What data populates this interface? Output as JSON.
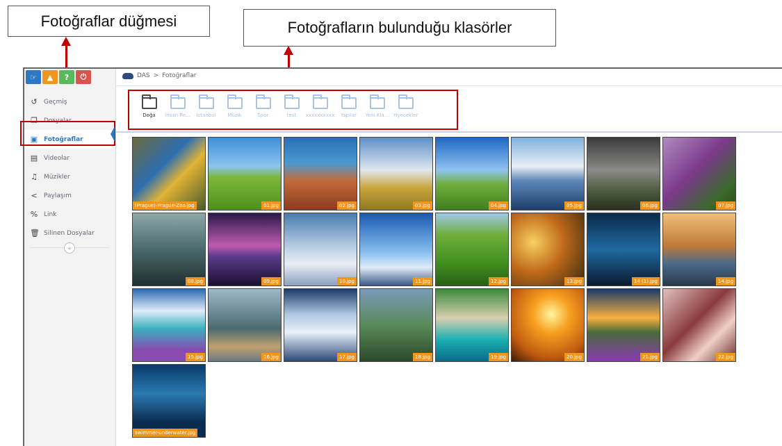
{
  "annotations": {
    "photos_button": "Fotoğraflar düğmesi",
    "folders": "Fotoğrafların bulunduğu klasörler"
  },
  "topbar": {
    "buttons": [
      {
        "name": "hand-icon",
        "color": "#2e77c5",
        "glyph": "☞"
      },
      {
        "name": "bell-icon",
        "color": "#f0961e",
        "glyph": "▲"
      },
      {
        "name": "help-icon",
        "color": "#5cb85c",
        "glyph": "?"
      },
      {
        "name": "power-icon",
        "color": "#d9534f",
        "glyph": "⏻"
      }
    ]
  },
  "sidebar": {
    "items": [
      {
        "label": "Geçmiş",
        "icon": "history-icon",
        "glyph": "↺",
        "active": false
      },
      {
        "label": "Dosyalar",
        "icon": "files-icon",
        "glyph": "❐",
        "active": false
      },
      {
        "label": "Fotoğraflar",
        "icon": "image-icon",
        "glyph": "▣",
        "active": true
      },
      {
        "label": "Videolar",
        "icon": "film-icon",
        "glyph": "▤",
        "active": false
      },
      {
        "label": "Müzikler",
        "icon": "music-icon",
        "glyph": "♫",
        "active": false
      },
      {
        "label": "Paylaşım",
        "icon": "share-icon",
        "glyph": "<",
        "active": false
      },
      {
        "label": "Link",
        "icon": "link-icon",
        "glyph": "%",
        "active": false
      },
      {
        "label": "Silinen Dosyalar",
        "icon": "trash-icon",
        "glyph": "🗑",
        "active": false
      }
    ],
    "collapse": "«"
  },
  "breadcrumb": {
    "root": "DAS",
    "separator": ">",
    "current": "Fotoğraflar"
  },
  "folders": [
    {
      "label": "Doğa",
      "selected": true
    },
    {
      "label": "İnsan Re...",
      "selected": false
    },
    {
      "label": "İstanbul",
      "selected": false
    },
    {
      "label": "Müzik",
      "selected": false
    },
    {
      "label": "Spor",
      "selected": false
    },
    {
      "label": "test",
      "selected": false
    },
    {
      "label": "xxxxxxxxxx",
      "selected": false
    },
    {
      "label": "Yapılar",
      "selected": false
    },
    {
      "label": "Yeni Kla...",
      "selected": false
    },
    {
      "label": "Yiyecekler",
      "selected": false
    }
  ],
  "photos": [
    {
      "label": "(Prague)-Prague-Zoo.jpg",
      "bg": "linear-gradient(135deg,#6b6a3a,#2d6db0 40%,#e2b437 60%,#4a5b2a)"
    },
    {
      "label": "01.jpg",
      "bg": "linear-gradient(#3d8fd6 0%,#8cc4ee 40%,#7db83a 55%,#4f8f1f)"
    },
    {
      "label": "02.jpg",
      "bg": "linear-gradient(#2a6fb7 0%,#4a9ad0 35%,#c46a3a 60%,#8a3b20)"
    },
    {
      "label": "03.jpg",
      "bg": "linear-gradient(#5f8fc8,#dfe7f0 45%,#c9a43a 70%,#8f7a25)"
    },
    {
      "label": "04.jpg",
      "bg": "linear-gradient(#1f66c4,#8fc3f0 45%,#6fae3a 65%,#3f7f1f)"
    },
    {
      "label": "05.jpg",
      "bg": "linear-gradient(#7fb2e0,#e8eef5 40%,#5b86b8 60%,#1f3f6a)"
    },
    {
      "label": "06.jpg",
      "bg": "linear-gradient(#3a3a3a,#8a8a88 45%,#4a5a3a 75%,#2a3020)"
    },
    {
      "label": "07.jpg",
      "bg": "linear-gradient(135deg,#b08ac0,#7a3a8a 45%,#3a6a2a 80%,#2a4a20)"
    },
    {
      "label": "08.jpg",
      "bg": "linear-gradient(#8fa8a8,#4a6a6a 50%,#1f2f30)"
    },
    {
      "label": "09.jpg",
      "bg": "linear-gradient(#2a1a4a,#c05ab0 45%,#5a3a8a 60%,#1a1030)"
    },
    {
      "label": "10.jpg",
      "bg": "linear-gradient(#4a7ab0,#c0d4e8 50%,#e8eef5 70%,#8aa0c0)"
    },
    {
      "label": "11.jpg",
      "bg": "linear-gradient(#1a5ab0,#8ac0f0 55%,#e0ecf8 75%,#3a5a8a)"
    },
    {
      "label": "12.jpg",
      "bg": "linear-gradient(#a0c8e8,#6fae3a 30%,#3f8f1f 70%,#2a5f15)"
    },
    {
      "label": "13.jpg",
      "bg": "radial-gradient(circle at 30% 40%,#f8d060,#c06a1a 45%,#3a2a10)"
    },
    {
      "label": "14 (1).jpg",
      "bg": "linear-gradient(#0a2a4a,#1f6aa0 50%,#0a1a30)"
    },
    {
      "label": "14.jpg",
      "bg": "linear-gradient(#f0c07a,#c07a3a 45%,#4a6a8a 70%,#2a3a4a)"
    },
    {
      "label": "15.jpg",
      "bg": "linear-gradient(#2a6ab0,#e0ecf8 30%,#3ab0c0 55%,#8a4ab0 85%)"
    },
    {
      "label": "16.jpg",
      "bg": "linear-gradient(#a0b8c8,#4a6a70 55%,#c0a070 80%,#6a7a80)"
    },
    {
      "label": "17.jpg",
      "bg": "linear-gradient(#1a3a6a,#b0c8e0 35%,#e8f0f8 60%,#2a4a7a)"
    },
    {
      "label": "18.jpg",
      "bg": "linear-gradient(#7a9ab8,#5a8a5a 50%,#2a4a2a)"
    },
    {
      "label": "19.jpg",
      "bg": "linear-gradient(#3a8a3a,#d8d0b0 40%,#1ab0b0 70%,#0a6a8a)"
    },
    {
      "label": "20.jpg",
      "bg": "radial-gradient(circle at 55% 35%,#fff6a0,#f8a020 30%,#c05a10 70%,#3a1a08)"
    },
    {
      "label": "21.jpg",
      "bg": "linear-gradient(#1a3a6a,#f8b040 40%,#4a6a3a 60%,#8a3ab0)"
    },
    {
      "label": "22.jpg",
      "bg": "linear-gradient(135deg,#e0c0c0,#8a3a3a 45%,#f0d0c8 70%,#6a2a2a)"
    },
    {
      "label": "swimmer-underwater.jpg",
      "bg": "linear-gradient(#0a3a6a,#2a7ab0 40%,#0a2a50 80%)"
    }
  ]
}
